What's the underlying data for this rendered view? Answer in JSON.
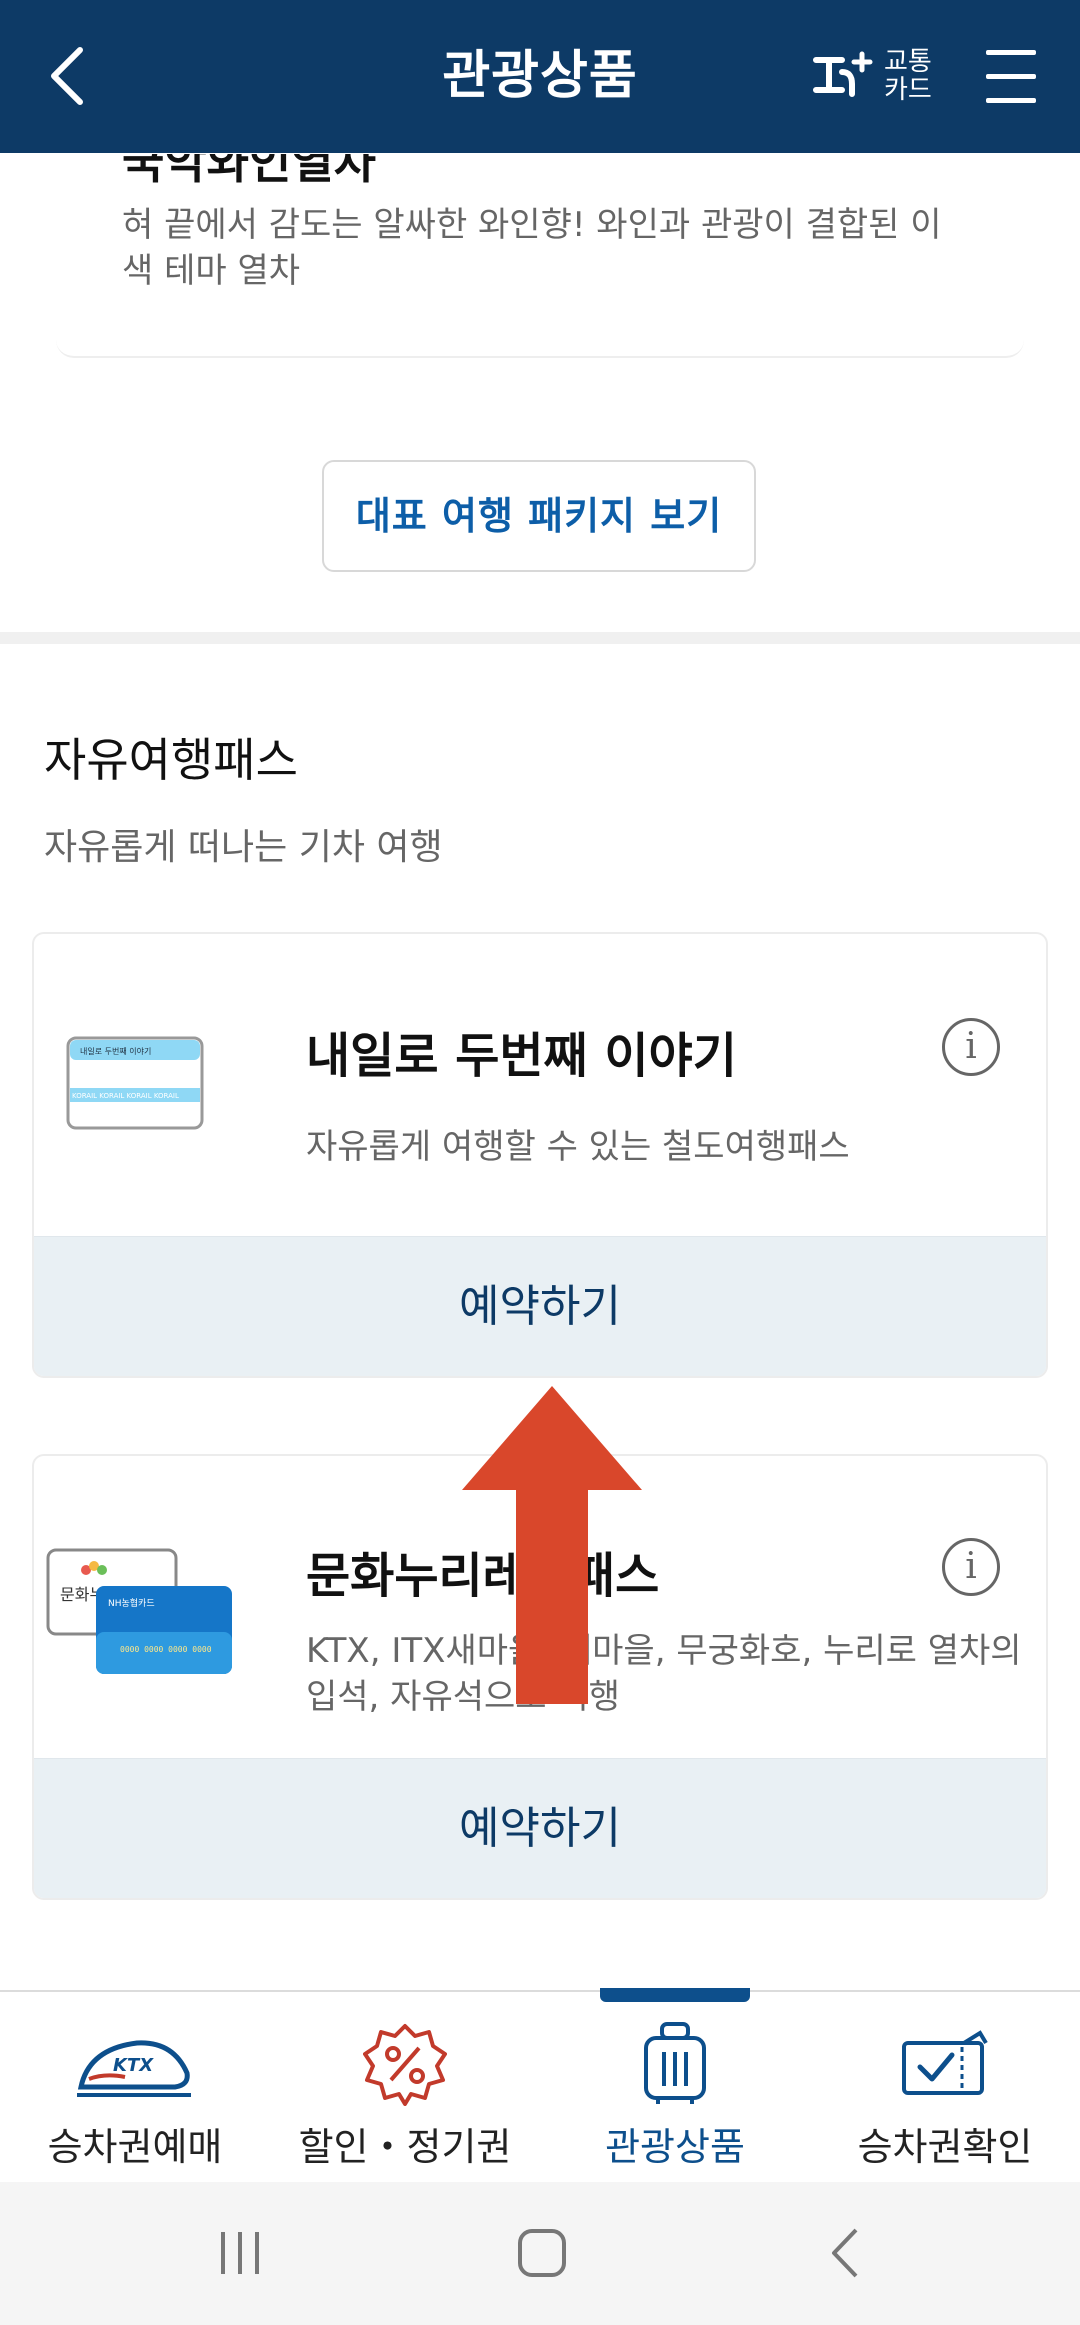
{
  "header": {
    "title": "관광상품",
    "back_icon": "back-arrow-icon",
    "tcard_label_1": "교통",
    "tcard_label_2": "카드",
    "menu_icon": "hamburger-menu-icon"
  },
  "prev_item": {
    "title": "국악와인열차",
    "description": "혀 끝에서 감도는 알싸한 와인향! 와인과 관광이 결합된 이색 테마 열차"
  },
  "package_button": "대표 여행 패키지 보기",
  "section": {
    "title": "자유여행패스",
    "subtitle": "자유롭게 떠나는 기차 여행"
  },
  "passes": [
    {
      "name": "내일로 두번째 이야기",
      "description": "자유롭게 여행할 수 있는 철도여행패스",
      "reserve_label": "예약하기",
      "thumb_text": "내일로 두번째 이야기",
      "thumb_strip": "KORAIL KORAIL KORAIL KORAIL"
    },
    {
      "name": "문화누리레일패스",
      "description": "KTX, ITX새마을, 새마을, 무궁화호, 누리로 열차의 입석, 자유석으로 여행",
      "reserve_label": "예약하기",
      "thumb_text_1": "문화누리",
      "thumb_text_2": "NH농협카드",
      "thumb_number": "0000 0000 0000 0000"
    }
  ],
  "bottom_nav": [
    {
      "label": "승차권예매",
      "icon": "ktx-train-icon",
      "active": false
    },
    {
      "label": "할인・정기권",
      "icon": "discount-badge-icon",
      "active": false
    },
    {
      "label": "관광상품",
      "icon": "suitcase-icon",
      "active": true
    },
    {
      "label": "승차권확인",
      "icon": "ticket-check-icon",
      "active": false
    }
  ],
  "colors": {
    "header_bg": "#0d3a66",
    "accent": "#0d5ea8",
    "arrow": "#d9472b",
    "reserve_bg": "#e9f0f4"
  }
}
